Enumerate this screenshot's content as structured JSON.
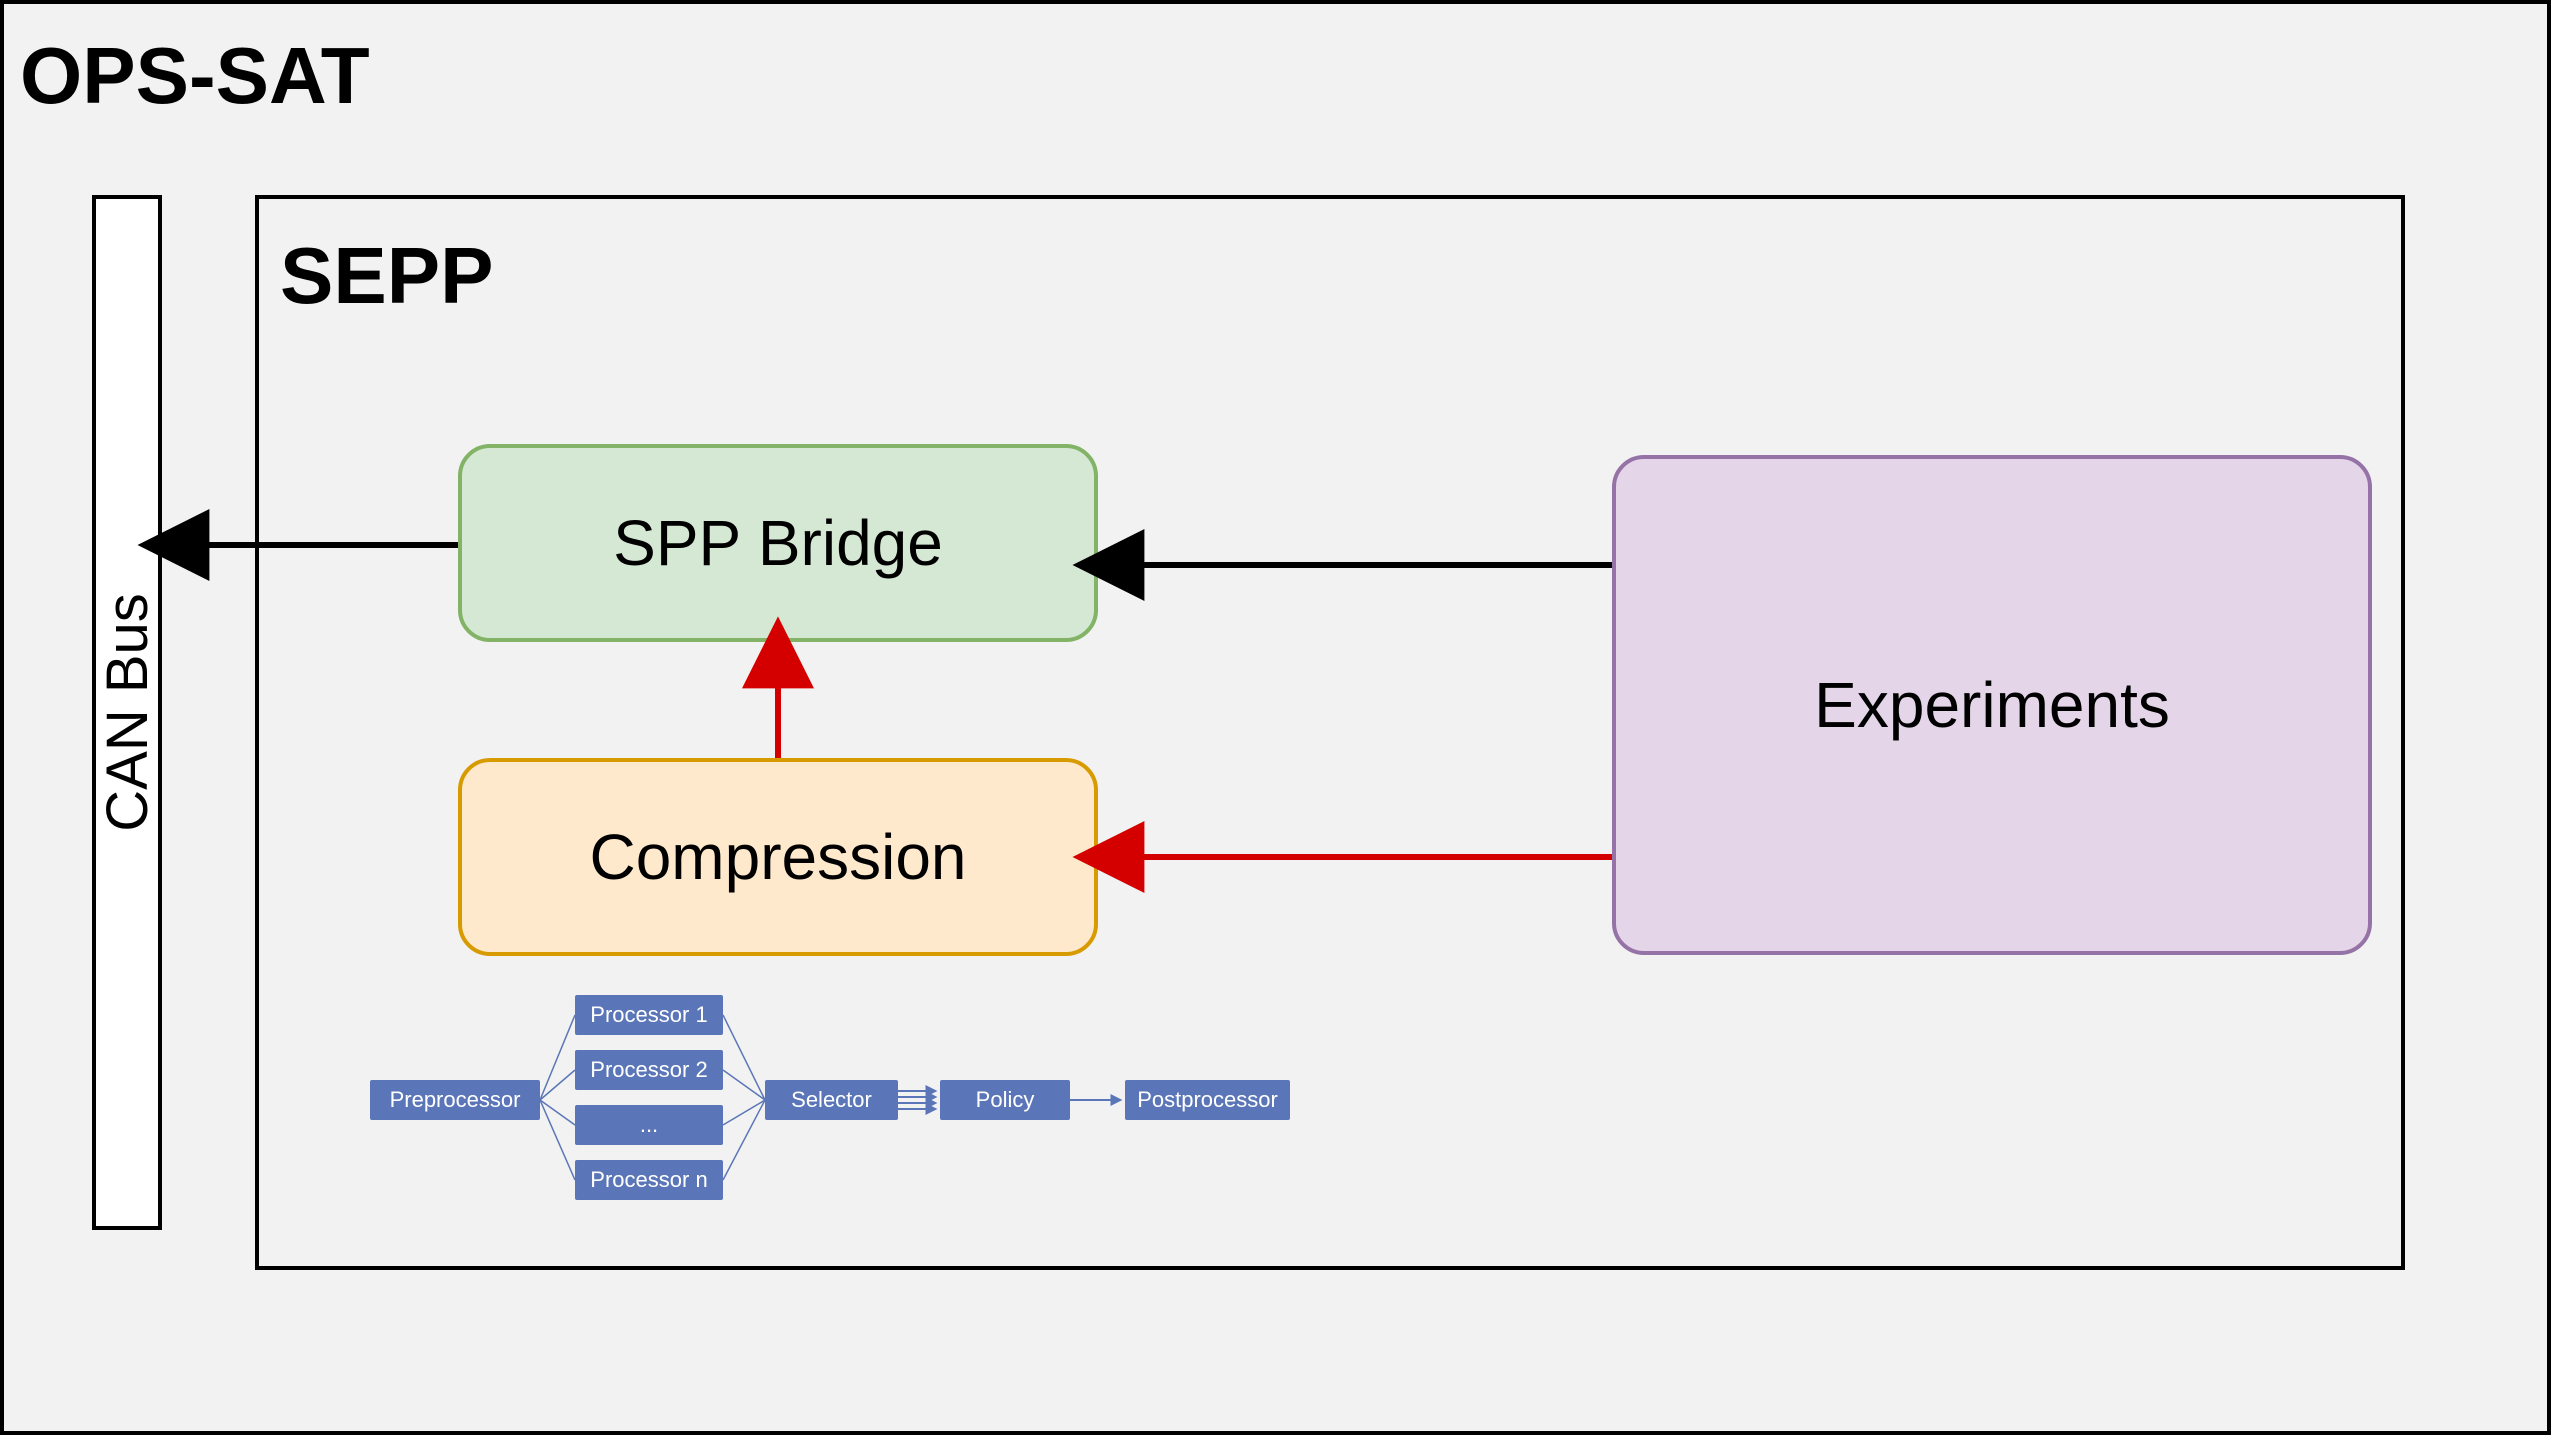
{
  "title": "OPS-SAT",
  "can_bus": "CAN Bus",
  "sepp": {
    "label": "SEPP"
  },
  "nodes": {
    "spp_bridge": "SPP Bridge",
    "compression": "Compression",
    "experiments": "Experiments"
  },
  "pipeline": {
    "preprocessor": "Preprocessor",
    "processors": [
      "Processor 1",
      "Processor 2",
      "...",
      "Processor n"
    ],
    "selector": "Selector",
    "policy": "Policy",
    "postprocessor": "Postprocessor"
  },
  "colors": {
    "accent_red": "#d40000",
    "pipeline_blue": "#5b76b8"
  }
}
